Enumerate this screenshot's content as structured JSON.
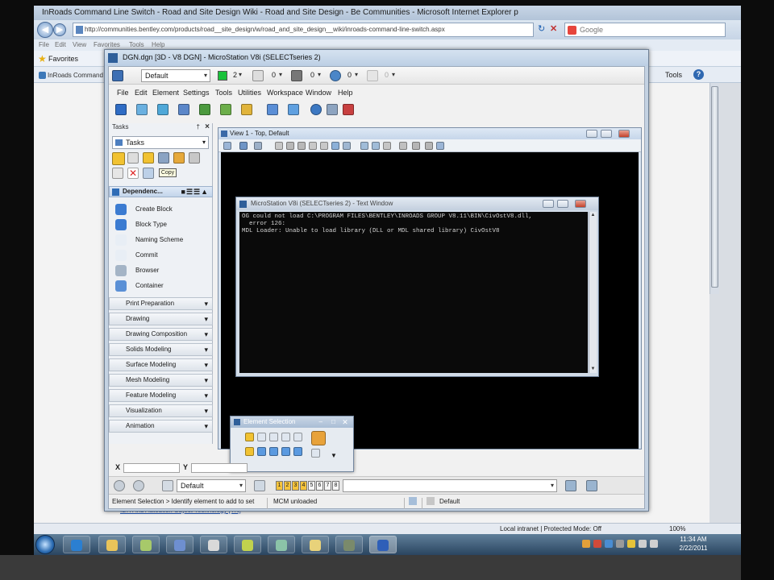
{
  "ie": {
    "title": "InRoads Command Line Switch - Road and Site Design Wiki - Road and Site Design - Be Communities - Microsoft Internet Explorer p",
    "address": "http://communities.bentley.com/products/road__site_design/w/road_and_site_design__wiki/inroads-command-line-switch.aspx",
    "search_placeholder": "Google",
    "menu": [
      "File",
      "Edit",
      "View",
      "Favorites",
      "Tools",
      "Help"
    ],
    "favorites_label": "Favorites",
    "tab_label": "InRoads Command ...",
    "tools_label": "Tools",
    "page_link": "IDX And Autodesk Object Technology [TN]",
    "status_zone": "Local intranet | Protected Mode: Off",
    "zoom": "100%"
  },
  "taskbar": {
    "time": "11:34 AM",
    "date": "2/22/2011"
  },
  "ms": {
    "title": "DGN.dgn [3D - V8 DGN] - MicroStation V8i (SELECTseries 2)",
    "level": "Default",
    "color_value": "2",
    "style_value": "0",
    "weight_value": "0",
    "transparency_value": "0",
    "priority_value": "0",
    "menu": [
      "File",
      "Edit",
      "Element",
      "Settings",
      "Tools",
      "Utilities",
      "Workspace",
      "Window",
      "Help"
    ],
    "tasks_title": "Tasks",
    "tasks_select": "Tasks",
    "tooltip": "Copy",
    "dependency_header": "Dependenc...",
    "dependency_items": [
      "Create Block",
      "Block Type",
      "Naming Scheme",
      "Commit",
      "Browser",
      "Container"
    ],
    "sections": [
      "Print Preparation",
      "Drawing",
      "Drawing Composition",
      "Solids Modeling",
      "Surface Modeling",
      "Mesh Modeling",
      "Feature Modeling",
      "Visualization",
      "Animation"
    ],
    "view_title": "View 1 - Top, Default",
    "text_window_title": "MicroStation V8i (SELECTseries 2) - Text Window",
    "text_lines": [
      "OG could not load C:\\PROGRAM FILES\\BENTLEY\\INROADS GROUP V8.11\\BIN\\CivOstV8.dll,",
      "  error 126:",
      "MDL Loader: Unable to load library (DLL or MDL shared library) CivOstV8"
    ],
    "element_selection_title": "Element Selection",
    "x_label": "X",
    "y_label": "Y",
    "bottom_level": "Default",
    "pages": [
      "1",
      "2",
      "3",
      "4",
      "5",
      "6",
      "7",
      "8"
    ],
    "status_prompt": "Element Selection > Identify element to add to set",
    "status_mdl": "MCM unloaded",
    "status_model": "Default"
  },
  "colors": {
    "accent": "#2f5f9a",
    "canvas": "#000000",
    "active_color": "#19c23a"
  }
}
